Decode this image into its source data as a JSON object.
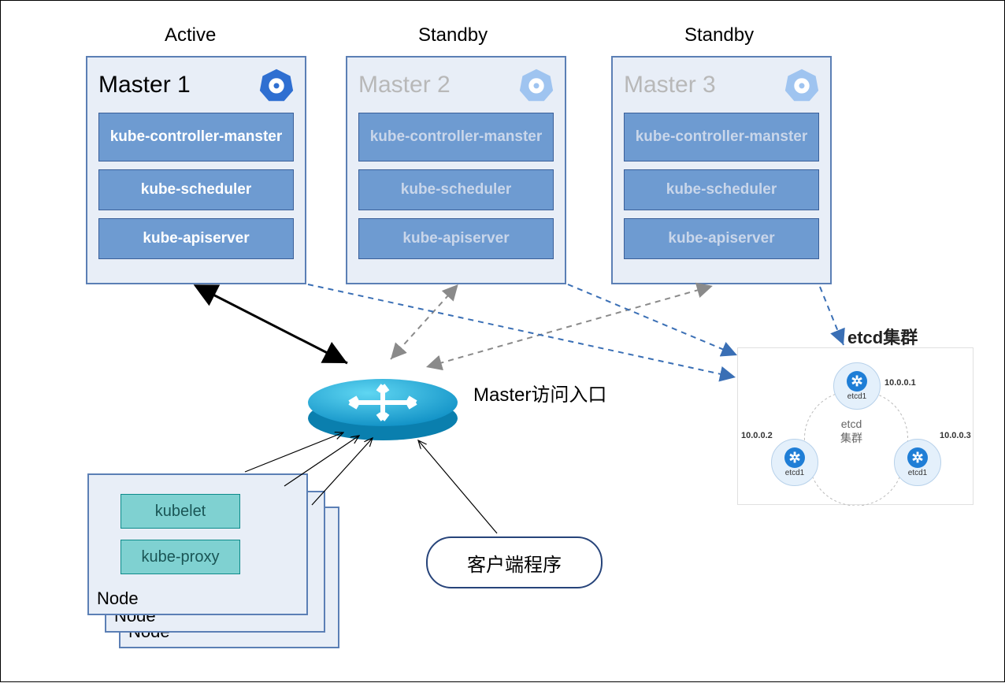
{
  "masters": [
    {
      "status": "Active",
      "title": "Master 1",
      "k8s_color": "#2f6fd1",
      "components": [
        "kube-controller-manster",
        "kube-scheduler",
        "kube-apiserver"
      ]
    },
    {
      "status": "Standby",
      "title": "Master 2",
      "k8s_color": "#9fc4f0",
      "components": [
        "kube-controller-manster",
        "kube-scheduler",
        "kube-apiserver"
      ]
    },
    {
      "status": "Standby",
      "title": "Master 3",
      "k8s_color": "#9fc4f0",
      "components": [
        "kube-controller-manster",
        "kube-scheduler",
        "kube-apiserver"
      ]
    }
  ],
  "router_label": "Master访问入口",
  "client_label": "客户端程序",
  "node": {
    "label": "Node",
    "components": [
      "kubelet",
      "kube-proxy"
    ]
  },
  "etcd": {
    "title": "etcd集群",
    "center": "etcd\n集群",
    "nodes": [
      {
        "name": "etcd1",
        "ip": "10.0.0.1"
      },
      {
        "name": "etcd1",
        "ip": "10.0.0.2"
      },
      {
        "name": "etcd1",
        "ip": "10.0.0.3"
      }
    ]
  }
}
